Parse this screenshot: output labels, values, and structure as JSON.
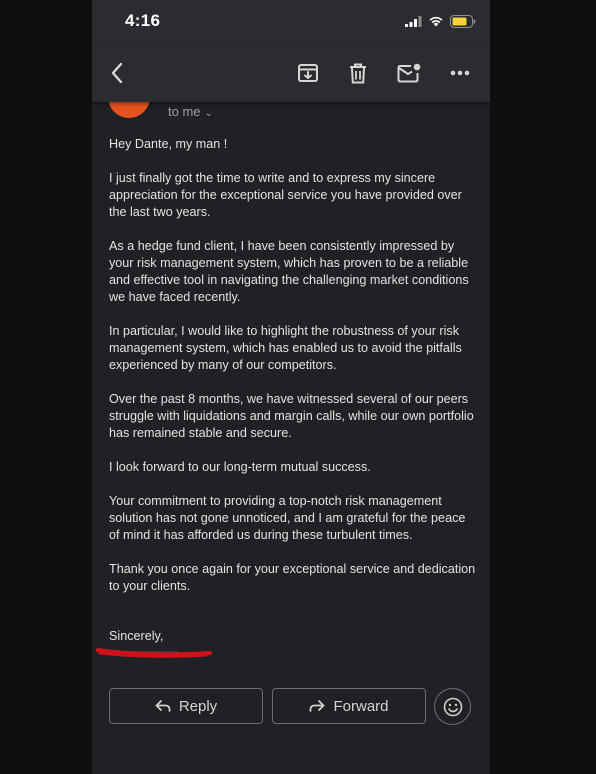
{
  "status_bar": {
    "time": "4:16"
  },
  "toolbar": {
    "back_icon": "chevron-left-icon",
    "actions": [
      "archive-icon",
      "delete-icon",
      "mark-unread-icon",
      "more-icon"
    ]
  },
  "email": {
    "recipient_label": "to me",
    "paragraphs": [
      "Hey Dante, my man !",
      "I just finally got the time to write and to express my sincere appreciation for the exceptional service you have provided over the last two years.",
      "As a hedge fund client, I have been consistently impressed by your risk management system, which has proven to be a reliable and effective tool in navigating the challenging market conditions we have faced recently.",
      "In particular, I would like to highlight the robustness of your risk management system, which has enabled us to avoid the pitfalls experienced by many of our competitors.",
      "Over the past 8 months, we have witnessed several of our peers struggle with liquidations and margin calls, while our own portfolio has remained stable and secure.",
      "I look forward to our long-term mutual success.",
      "Your commitment to providing a top-notch risk management solution has not gone unnoticed, and I am grateful for the peace of mind it has afforded us during these turbulent times.",
      "Thank you once again for your exceptional service and dedication to your clients."
    ],
    "closing": "Sincerely,"
  },
  "actions": {
    "reply_label": "Reply",
    "forward_label": "Forward"
  },
  "colors": {
    "background": "#202124",
    "bar": "#2b2c2f",
    "text": "#e3e3e3",
    "avatar": "#e8521f",
    "redaction": "#d0101a"
  }
}
